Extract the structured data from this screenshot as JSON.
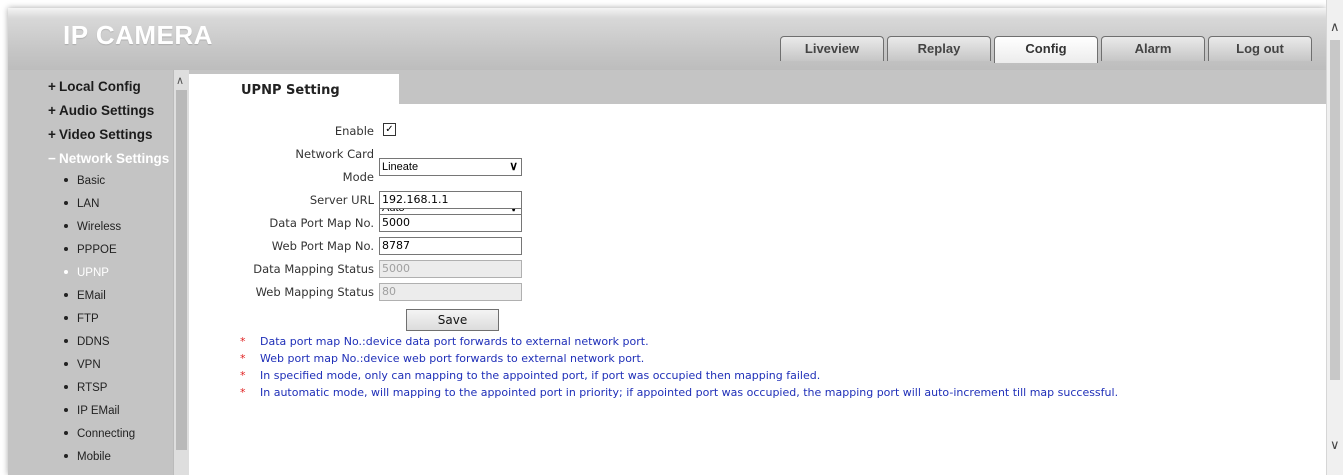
{
  "header": {
    "logo": "IP CAMERA"
  },
  "nav_tabs": [
    {
      "label": "Liveview",
      "active": false
    },
    {
      "label": "Replay",
      "active": false
    },
    {
      "label": "Config",
      "active": true
    },
    {
      "label": "Alarm",
      "active": false
    },
    {
      "label": "Log out",
      "active": false
    }
  ],
  "sidebar": {
    "sections": [
      {
        "sign": "+",
        "label": "Local Config"
      },
      {
        "sign": "+",
        "label": "Audio Settings"
      },
      {
        "sign": "+",
        "label": "Video Settings"
      },
      {
        "sign": "−",
        "label": "Network Settings"
      }
    ],
    "items": [
      "Basic",
      "LAN",
      "Wireless",
      "PPPOE",
      "UPNP",
      "EMail",
      "FTP",
      "DDNS",
      "VPN",
      "RTSP",
      "IP EMail",
      "Connecting",
      "Mobile"
    ],
    "active_item": "UPNP"
  },
  "page": {
    "tab_title": "UPNP Setting"
  },
  "form": {
    "enable_label": "Enable",
    "enable_checked": "✓",
    "network_card_label": "Network Card",
    "network_card_value": "Lineate",
    "mode_label": "Mode",
    "mode_value": "Auto",
    "server_url_label": "Server URL",
    "server_url_value": "192.168.1.1",
    "data_port_label": "Data Port Map No.",
    "data_port_value": "5000",
    "web_port_label": "Web Port Map No.",
    "web_port_value": "8787",
    "data_status_label": "Data Mapping Status",
    "data_status_value": "5000",
    "web_status_label": "Web Mapping Status",
    "web_status_value": "80",
    "save_label": "Save"
  },
  "notes": [
    "Data port map No.:device data port forwards to external network port.",
    "Web port map No.:device web port forwards to external network port.",
    "In specified mode, only can mapping to the appointed port, if port was occupied then mapping failed.",
    "In automatic mode, will mapping to the appointed port in priority; if appointed port was occupied, the mapping port will auto-increment till map successful."
  ],
  "note_marker": "*",
  "colors": {
    "note_text": "#1f2fb8",
    "note_marker": "#e02020",
    "frame_gray": "#c4c4c4"
  }
}
